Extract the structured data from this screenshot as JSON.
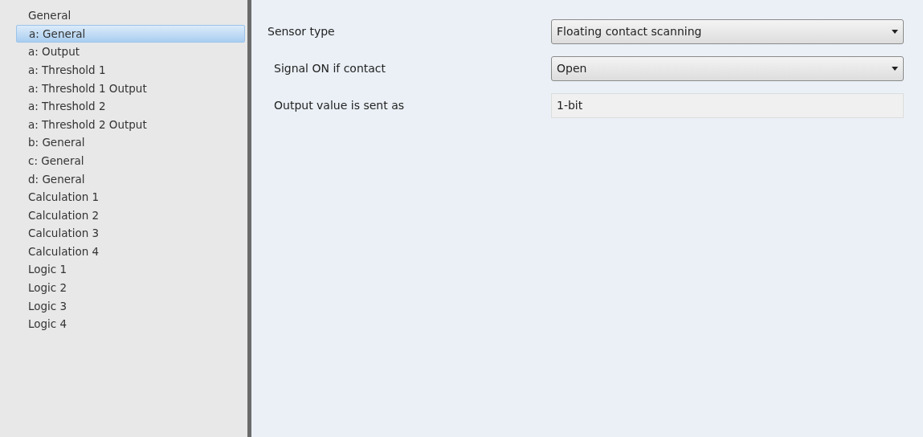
{
  "sidebar": {
    "items": [
      {
        "label": "General",
        "selected": false
      },
      {
        "label": "a: General",
        "selected": true
      },
      {
        "label": "a: Output",
        "selected": false
      },
      {
        "label": "a: Threshold 1",
        "selected": false
      },
      {
        "label": "a: Threshold 1 Output",
        "selected": false
      },
      {
        "label": "a: Threshold 2",
        "selected": false
      },
      {
        "label": "a: Threshold 2 Output",
        "selected": false
      },
      {
        "label": "b: General",
        "selected": false
      },
      {
        "label": "c: General",
        "selected": false
      },
      {
        "label": "d: General",
        "selected": false
      },
      {
        "label": "Calculation 1",
        "selected": false
      },
      {
        "label": "Calculation 2",
        "selected": false
      },
      {
        "label": "Calculation 3",
        "selected": false
      },
      {
        "label": "Calculation 4",
        "selected": false
      },
      {
        "label": "Logic 1",
        "selected": false
      },
      {
        "label": "Logic 2",
        "selected": false
      },
      {
        "label": "Logic 3",
        "selected": false
      },
      {
        "label": "Logic 4",
        "selected": false
      }
    ]
  },
  "parameters": [
    {
      "label": "Sensor type",
      "kind": "dropdown",
      "value": "Floating contact scanning",
      "children": [
        {
          "label": "Signal ON if contact",
          "kind": "dropdown",
          "value": "Open"
        },
        {
          "label": "Output value is sent as",
          "kind": "readonly",
          "value": "1-bit"
        }
      ]
    }
  ]
}
